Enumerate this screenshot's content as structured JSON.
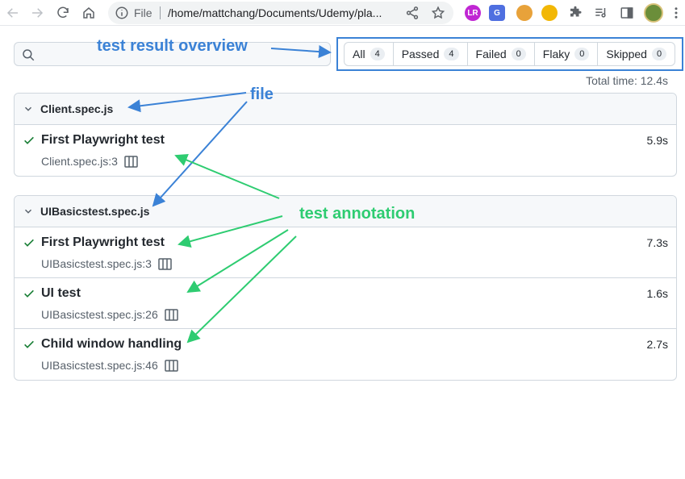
{
  "browser": {
    "scheme_label": "File",
    "url": "/home/mattchang/Documents/Udemy/pla...",
    "extensions": [
      {
        "name": "extension-lr",
        "text": "LR",
        "color": "#c026d3"
      },
      {
        "name": "extension-translate",
        "text": "G",
        "color": "#4f6fe0"
      },
      {
        "name": "extension-cookie",
        "text": "",
        "color": "#e8a23a"
      },
      {
        "name": "extension-gauge",
        "text": "",
        "color": "#f2b705"
      }
    ]
  },
  "search": {
    "placeholder": ""
  },
  "filters": [
    {
      "label": "All",
      "count": "4"
    },
    {
      "label": "Passed",
      "count": "4"
    },
    {
      "label": "Failed",
      "count": "0"
    },
    {
      "label": "Flaky",
      "count": "0"
    },
    {
      "label": "Skipped",
      "count": "0"
    }
  ],
  "total_time": "Total time: 12.4s",
  "files": [
    {
      "name": "Client.spec.js",
      "tests": [
        {
          "title": "First Playwright test",
          "location": "Client.spec.js:3",
          "duration": "5.9s"
        }
      ]
    },
    {
      "name": "UIBasicstest.spec.js",
      "tests": [
        {
          "title": "First Playwright test",
          "location": "UIBasicstest.spec.js:3",
          "duration": "7.3s"
        },
        {
          "title": "UI test",
          "location": "UIBasicstest.spec.js:26",
          "duration": "1.6s"
        },
        {
          "title": "Child window handling",
          "location": "UIBasicstest.spec.js:46",
          "duration": "2.7s"
        }
      ]
    }
  ],
  "annotations": {
    "overview": "test result overview",
    "file": "file",
    "test": "test annotation",
    "colors": {
      "blue": "#3b82d6",
      "green": "#2ecc71"
    }
  },
  "colors": {
    "pass": "#1a7f37",
    "border": "#d0d7de"
  }
}
